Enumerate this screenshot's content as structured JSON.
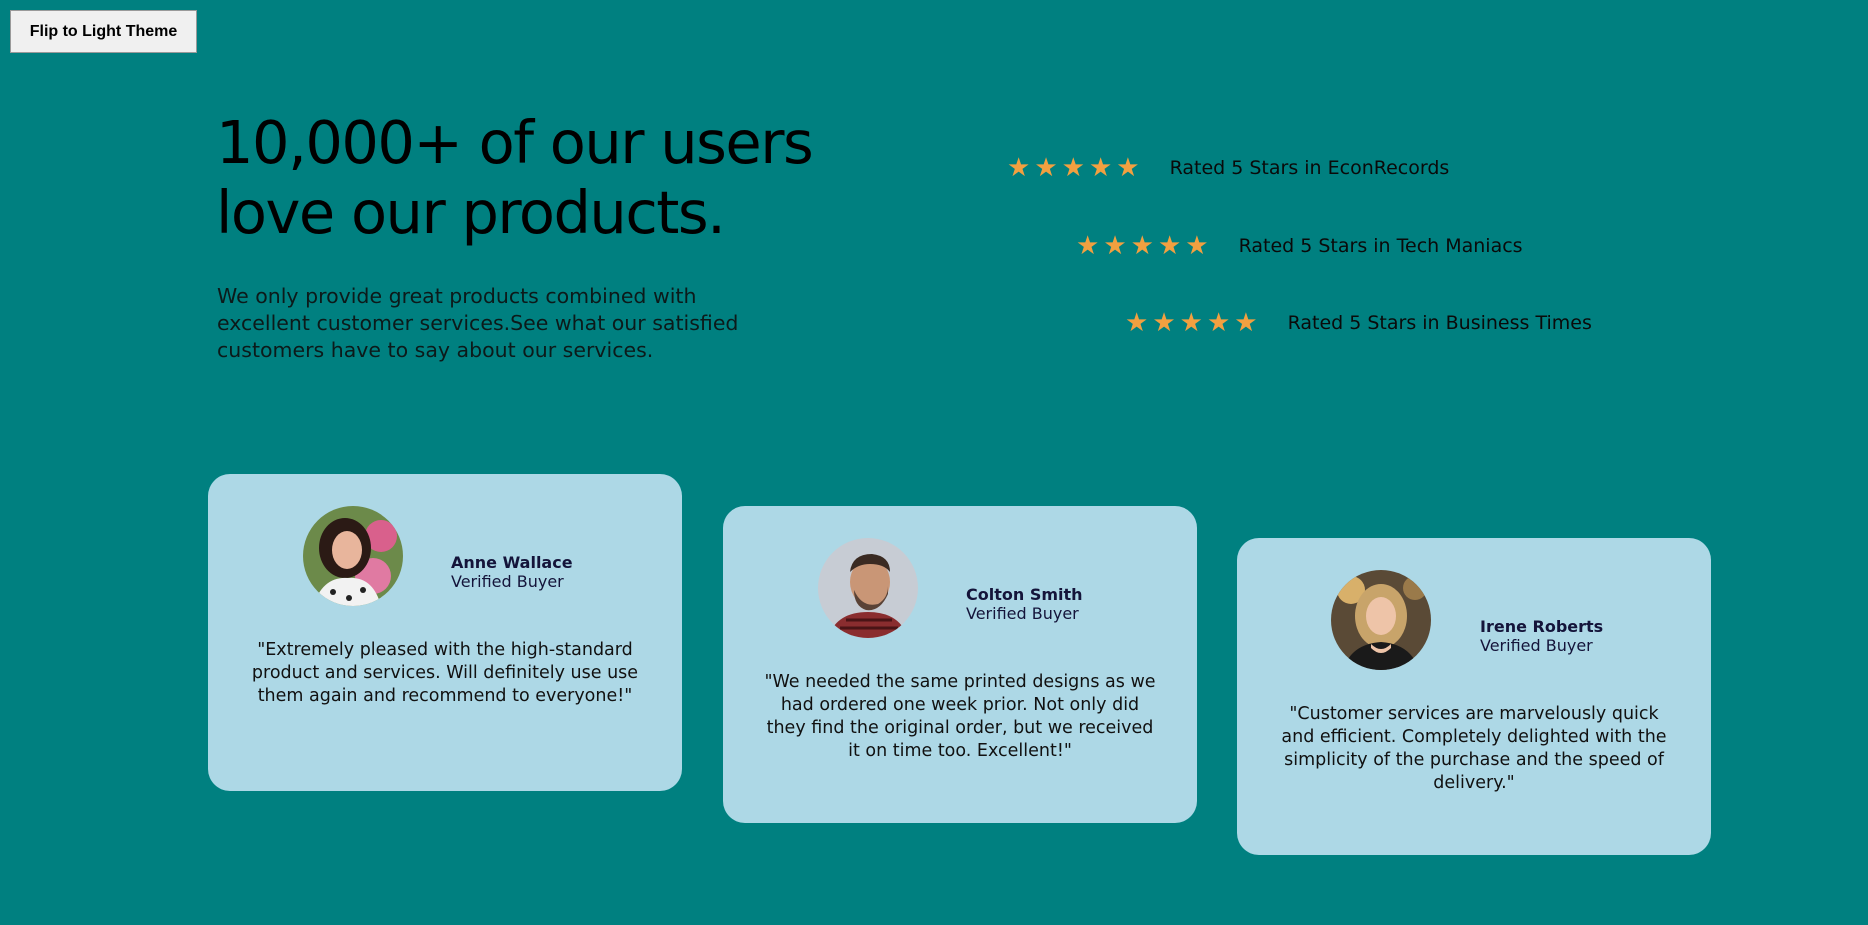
{
  "theme_button": {
    "label": "Flip to Light Theme"
  },
  "hero": {
    "headline": "10,000+ of our users love our products.",
    "intro": "We only provide great products combined with excellent customer services.See what our satisfied customers have to say about our services."
  },
  "colors": {
    "background": "#008080",
    "card": "#add8e6",
    "star": "#f2a040",
    "button": "#f0f0f0"
  },
  "ratings": [
    {
      "stars": 5,
      "text": "Rated 5 Stars in EconRecords"
    },
    {
      "stars": 5,
      "text": "Rated 5 Stars in Tech Maniacs"
    },
    {
      "stars": 5,
      "text": "Rated 5 Stars in Business Times"
    }
  ],
  "testimonials": [
    {
      "name": "Anne Wallace",
      "role": "Verified Buyer",
      "quote": "\"Extremely pleased with the high-standard product and services. Will definitely use use them again and recommend to everyone!\""
    },
    {
      "name": "Colton Smith",
      "role": "Verified Buyer",
      "quote": "\"We needed the same printed designs as we had ordered one week prior. Not only did they find the original order, but we received it on time too. Excellent!\""
    },
    {
      "name": "Irene Roberts",
      "role": "Verified Buyer",
      "quote": "\"Customer services are marvelously quick and efficient. Completely delighted with the simplicity of the purchase and the speed of delivery.\""
    }
  ]
}
